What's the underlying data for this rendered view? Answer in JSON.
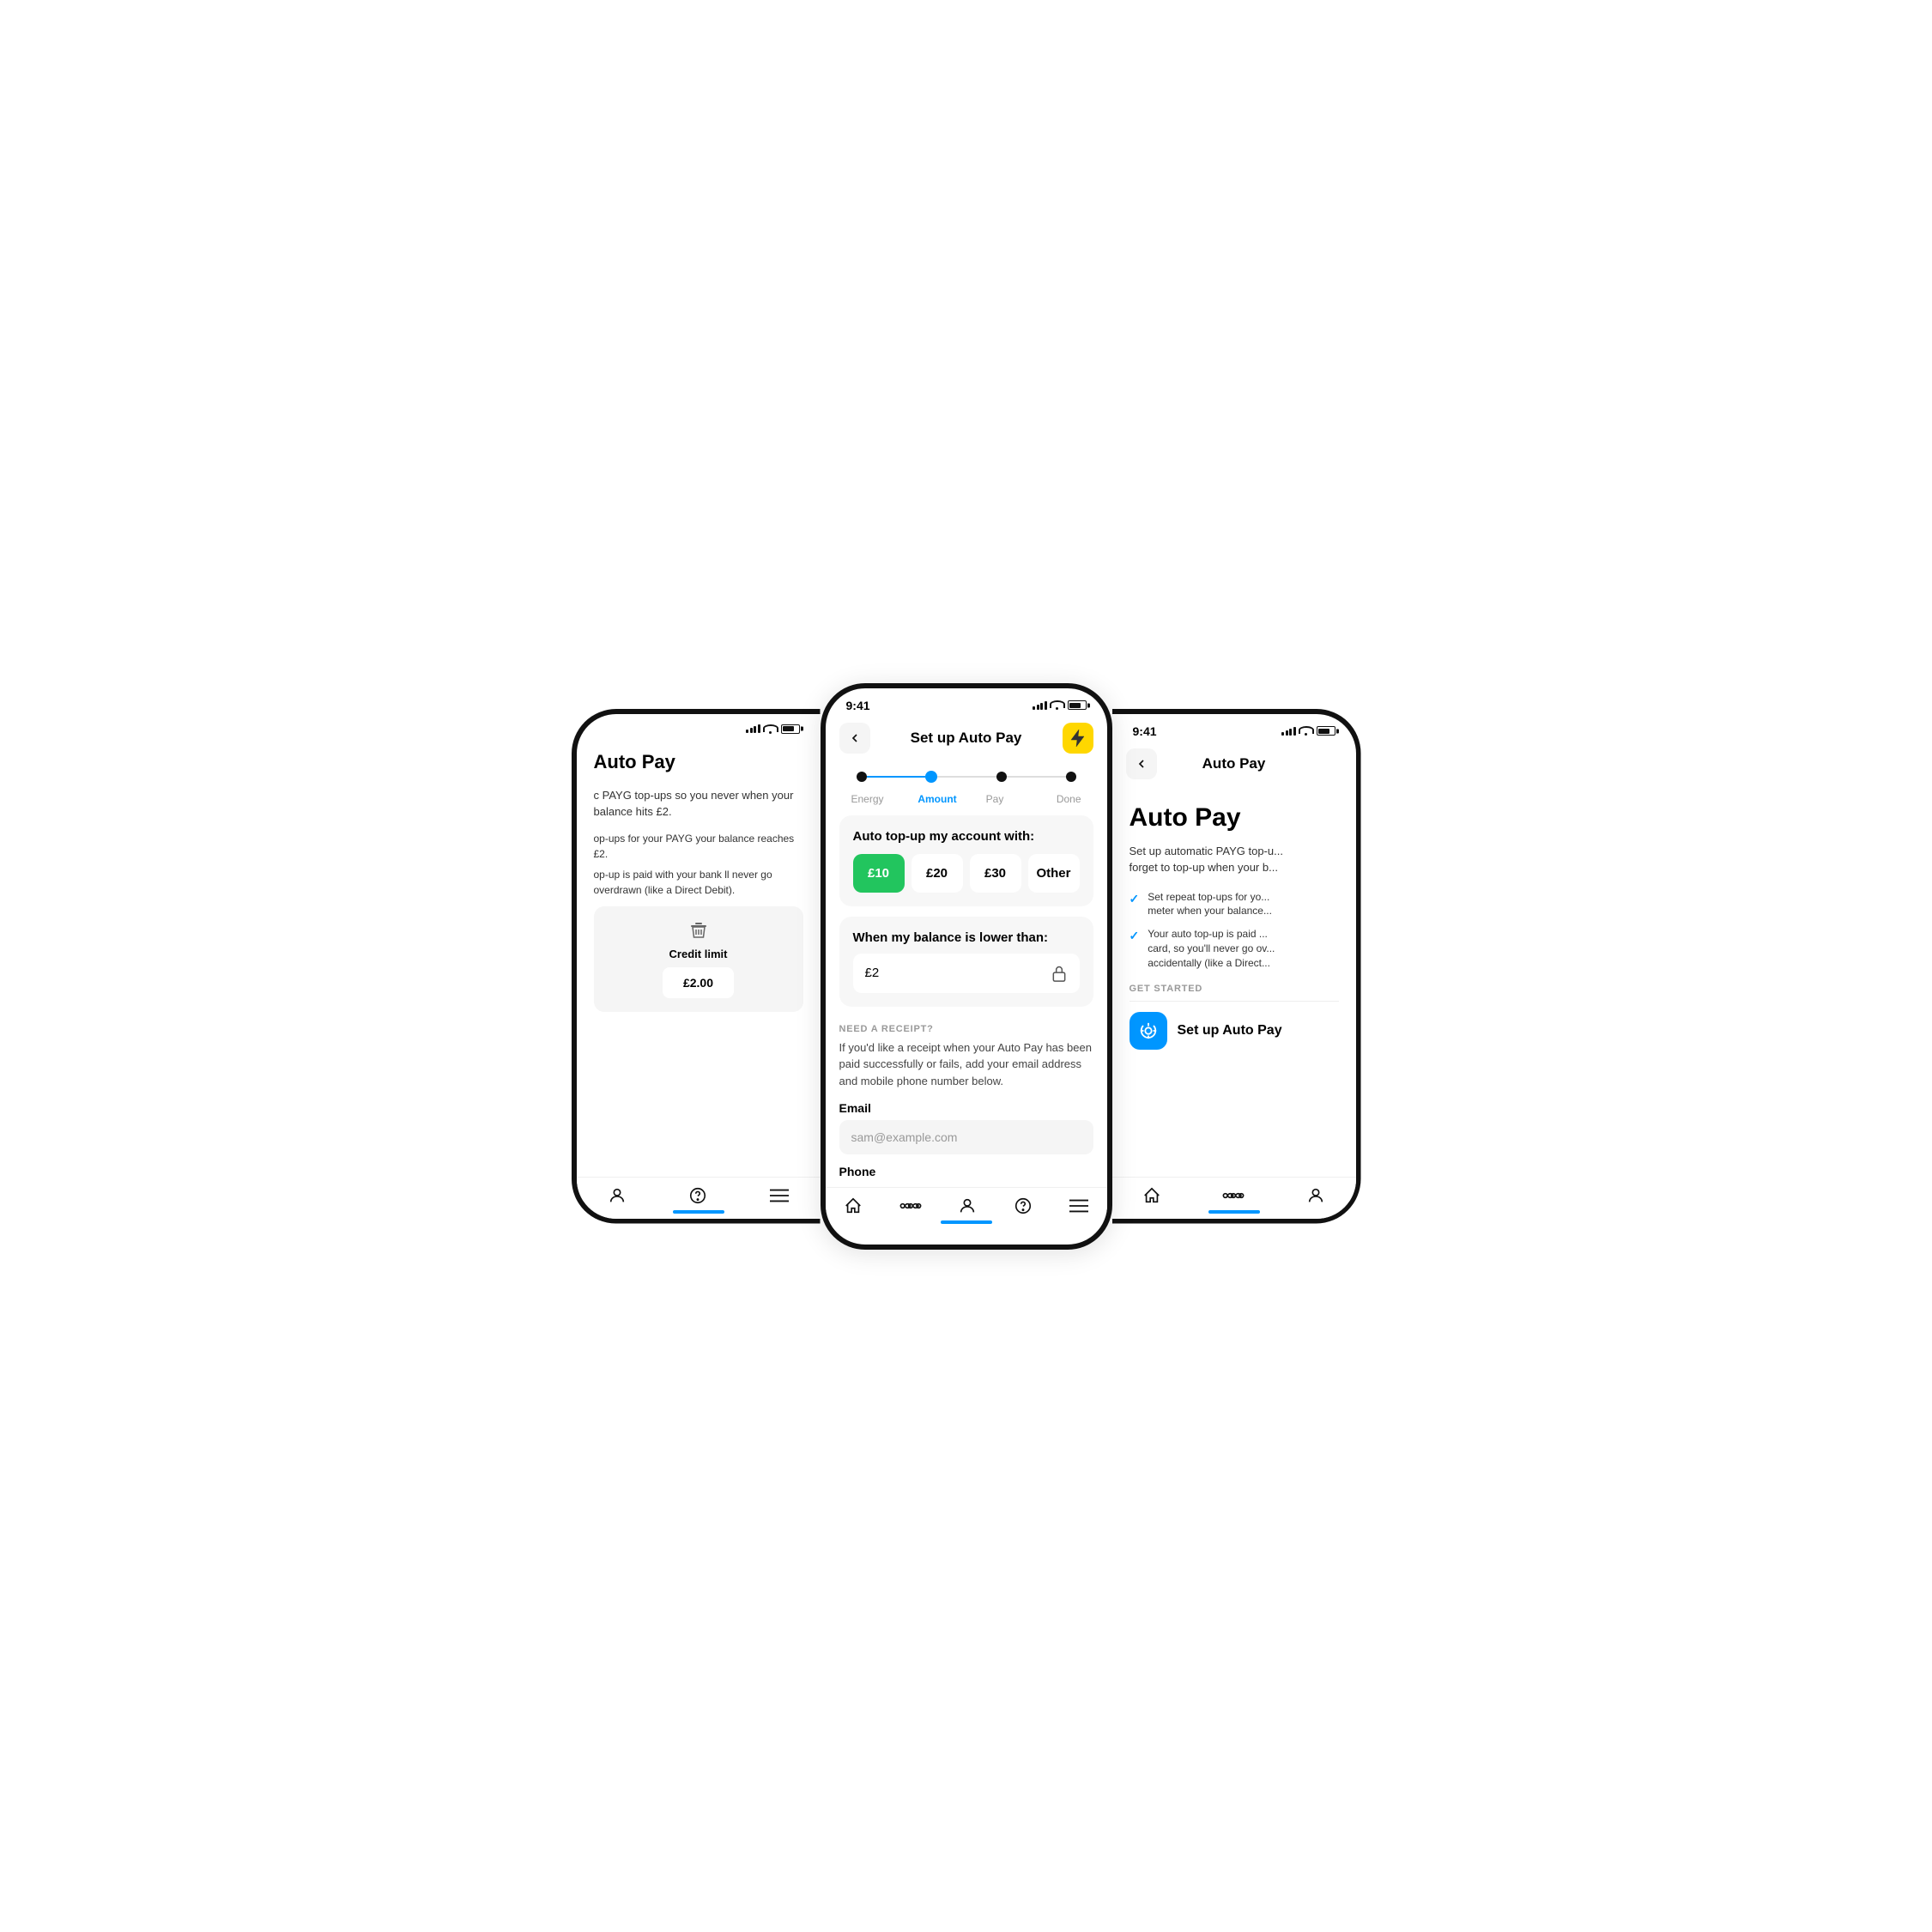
{
  "phones": {
    "left": {
      "status": {
        "time": "",
        "show_time": false
      },
      "title": "Auto Pay",
      "intro_text1": "c PAYG top-ups so you never when your balance hits £2.",
      "intro_text2": "op-ups for your PAYG your balance reaches £2.",
      "intro_text3": "op-up is paid with your bank ll never go overdrawn (like a Direct Debit).",
      "credit_limit_label": "Credit limit",
      "credit_limit_value": "£2.00",
      "nav_icons": [
        "home",
        "network",
        "account",
        "help",
        "menu"
      ]
    },
    "center": {
      "status": {
        "time": "9:41"
      },
      "header": {
        "back_label": "←",
        "title": "Set up Auto Pay",
        "lightning": "⚡"
      },
      "steps": [
        {
          "label": "Energy",
          "active": false
        },
        {
          "label": "Amount",
          "active": true
        },
        {
          "label": "Pay",
          "active": false
        },
        {
          "label": "Done",
          "active": false
        }
      ],
      "top_up_card": {
        "title": "Auto top-up my account with:",
        "options": [
          {
            "label": "£10",
            "selected": true
          },
          {
            "label": "£20",
            "selected": false
          },
          {
            "label": "£30",
            "selected": false
          },
          {
            "label": "Other",
            "selected": false
          }
        ]
      },
      "balance_card": {
        "title": "When my balance is lower than:",
        "value": "£2"
      },
      "receipt_section": {
        "label": "NEED A RECEIPT?",
        "description": "If you'd like a receipt when your Auto Pay has been paid successfully or fails, add your email address and mobile phone number below.",
        "email_label": "Email",
        "email_placeholder": "sam@example.com",
        "phone_label": "Phone"
      }
    },
    "right": {
      "status": {
        "time": "9:41"
      },
      "header": {
        "back_label": "←",
        "title": "Auto Pay"
      },
      "autopay_title": "Auto Pay",
      "autopay_desc": "Set up automatic PAYG top-u... forget to top-up when your b...",
      "features": [
        "Set repeat top-ups for yo... meter when your balance...",
        "Your auto top-up is paid ... card, so you'll never go ov... accidentally (like a Direct..."
      ],
      "get_started_label": "GET STARTED",
      "setup_button_text": "Set up Auto Pay"
    }
  }
}
